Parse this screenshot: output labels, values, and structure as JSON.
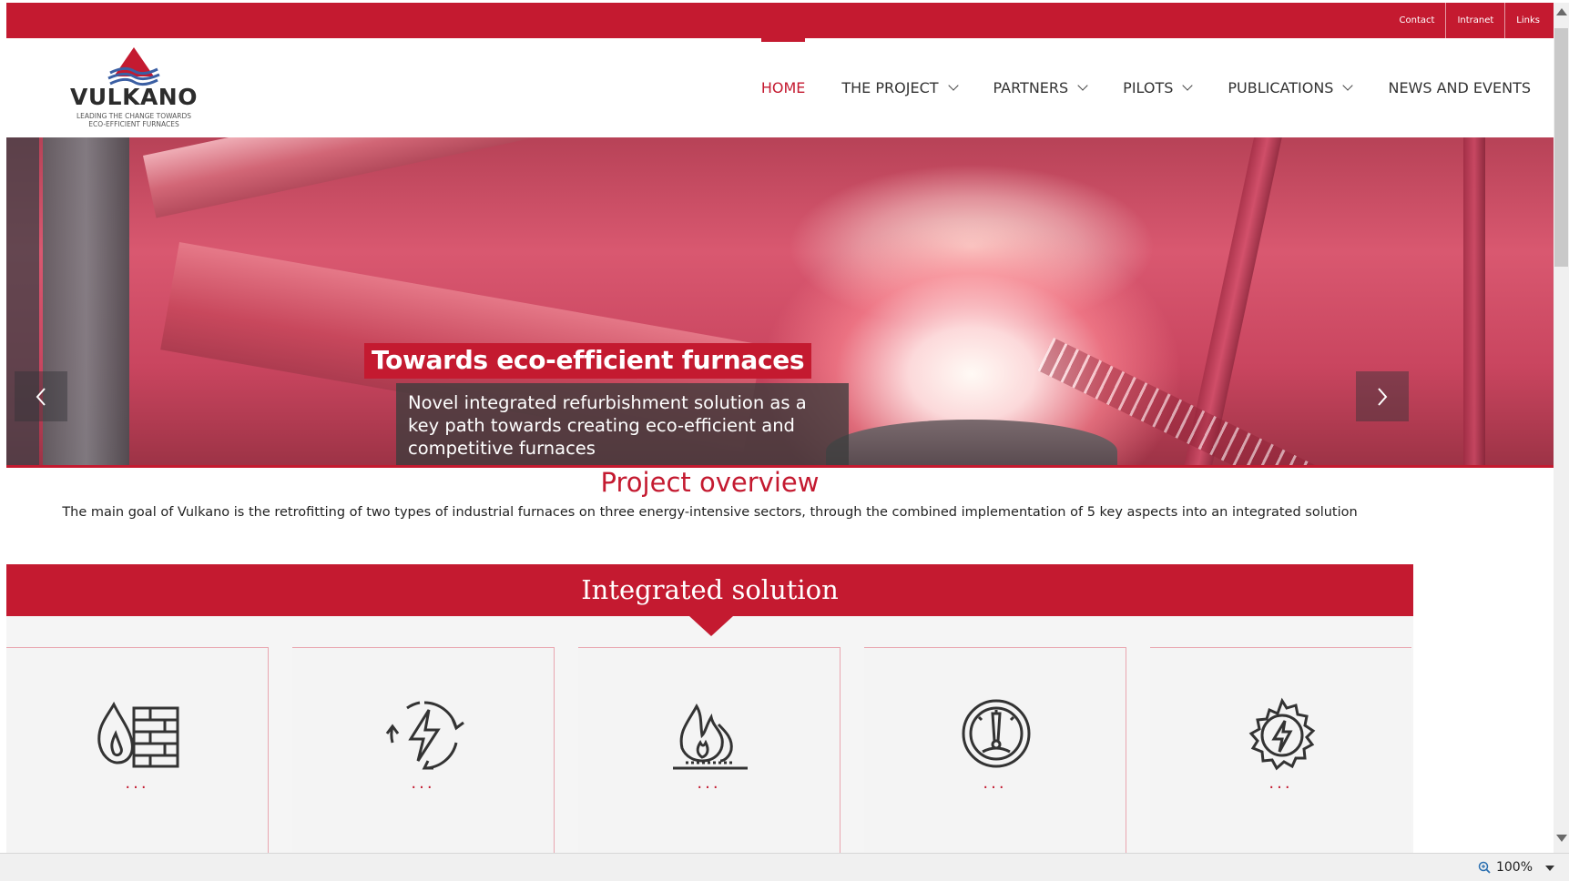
{
  "topbar": {
    "links": [
      "Contact",
      "Intranet",
      "Links"
    ]
  },
  "brand": {
    "name": "VULKANO",
    "tagline_line1": "LEADING THE CHANGE TOWARDS",
    "tagline_line2": "ECO-EFFICIENT FURNACES",
    "accent_color": "#c41a30"
  },
  "nav": {
    "items": [
      {
        "label": "HOME",
        "active": true,
        "dropdown": false
      },
      {
        "label": "THE PROJECT",
        "dropdown": true
      },
      {
        "label": "PARTNERS",
        "dropdown": true
      },
      {
        "label": "PILOTS",
        "dropdown": true
      },
      {
        "label": "PUBLICATIONS",
        "dropdown": true
      },
      {
        "label": "NEWS AND EVENTS",
        "dropdown": false
      }
    ]
  },
  "hero": {
    "title": "Towards eco-efficient furnaces",
    "subtitle": "Novel integrated refurbishment solution as a key path towards creating eco-efficient and competitive furnaces",
    "slides": 3,
    "active_slide": 1
  },
  "overview": {
    "title": "Project overview",
    "text": "The main goal of Vulkano is the retrofitting of two types of industrial furnaces on three energy-intensive sectors, through the combined implementation of 5 key aspects into an integrated solution"
  },
  "integrated": {
    "title": "Integrated solution",
    "cards": [
      {
        "icon": "brick-wall-flame-icon",
        "caption": "..."
      },
      {
        "icon": "energy-cycle-icon",
        "caption": "..."
      },
      {
        "icon": "flame-burner-icon",
        "caption": "..."
      },
      {
        "icon": "gauge-icon",
        "caption": "..."
      },
      {
        "icon": "gear-lightning-icon",
        "caption": "..."
      }
    ]
  },
  "statusbar": {
    "zoom": "100%"
  }
}
